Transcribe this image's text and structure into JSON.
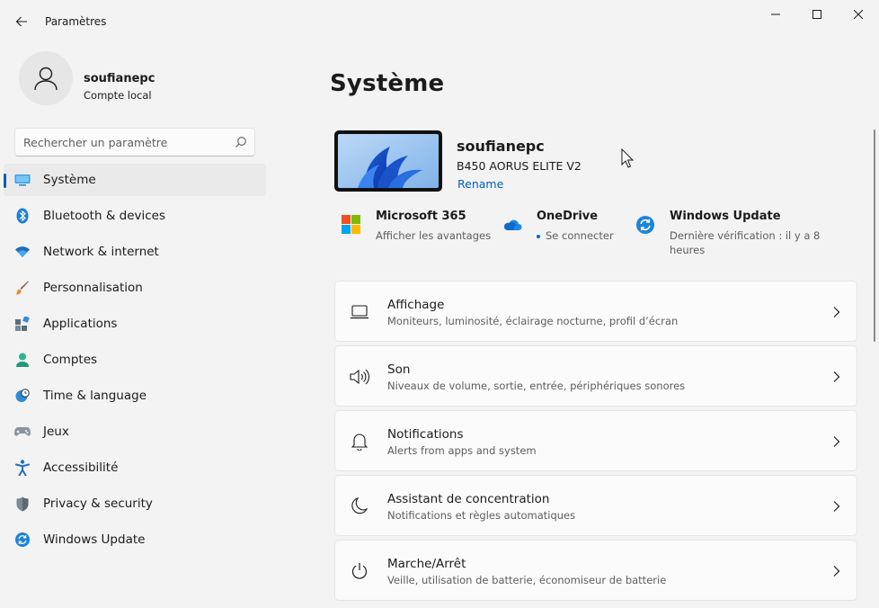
{
  "window": {
    "title": "Paramètres"
  },
  "user": {
    "name": "soufianepc",
    "account_type": "Compte local"
  },
  "search": {
    "placeholder": "Rechercher un paramètre"
  },
  "sidebar": {
    "items": [
      {
        "label": "Système",
        "icon": "system-icon",
        "active": true
      },
      {
        "label": "Bluetooth & devices",
        "icon": "bluetooth-icon"
      },
      {
        "label": "Network & internet",
        "icon": "wifi-icon"
      },
      {
        "label": "Personnalisation",
        "icon": "brush-icon"
      },
      {
        "label": "Applications",
        "icon": "apps-icon"
      },
      {
        "label": "Comptes",
        "icon": "person-icon"
      },
      {
        "label": "Time & language",
        "icon": "clock-globe-icon"
      },
      {
        "label": "Jeux",
        "icon": "gamepad-icon"
      },
      {
        "label": "Accessibilité",
        "icon": "accessibility-icon"
      },
      {
        "label": "Privacy & security",
        "icon": "shield-icon"
      },
      {
        "label": "Windows Update",
        "icon": "update-icon"
      }
    ]
  },
  "main": {
    "title": "Système",
    "device": {
      "name": "soufianepc",
      "model": "B450 AORUS ELITE V2",
      "rename": "Rename"
    },
    "quick_links": [
      {
        "title": "Microsoft 365",
        "subtitle": "Afficher les avantages",
        "icon": "microsoft-logo-icon"
      },
      {
        "title": "OneDrive",
        "subtitle": "Se connecter",
        "icon": "onedrive-cloud-icon"
      },
      {
        "title": "Windows Update",
        "subtitle": "Dernière vérification : il y a 8 heures",
        "icon": "update-icon"
      }
    ],
    "cards": [
      {
        "title": "Affichage",
        "subtitle": "Moniteurs, luminosité, éclairage nocturne, profil d’écran",
        "icon": "laptop-icon"
      },
      {
        "title": "Son",
        "subtitle": "Niveaux de volume, sortie, entrée, périphériques sonores",
        "icon": "speaker-icon"
      },
      {
        "title": "Notifications",
        "subtitle": "Alerts from apps and system",
        "icon": "bell-icon"
      },
      {
        "title": "Assistant de concentration",
        "subtitle": "Notifications et règles automatiques",
        "icon": "moon-icon"
      },
      {
        "title": "Marche/Arrêt",
        "subtitle": "Veille, utilisation de batterie, économiseur de batterie",
        "icon": "power-icon"
      }
    ]
  },
  "colors": {
    "accent": "#005fb8",
    "background": "#f3f3f3",
    "card": "#fbfbfb"
  }
}
